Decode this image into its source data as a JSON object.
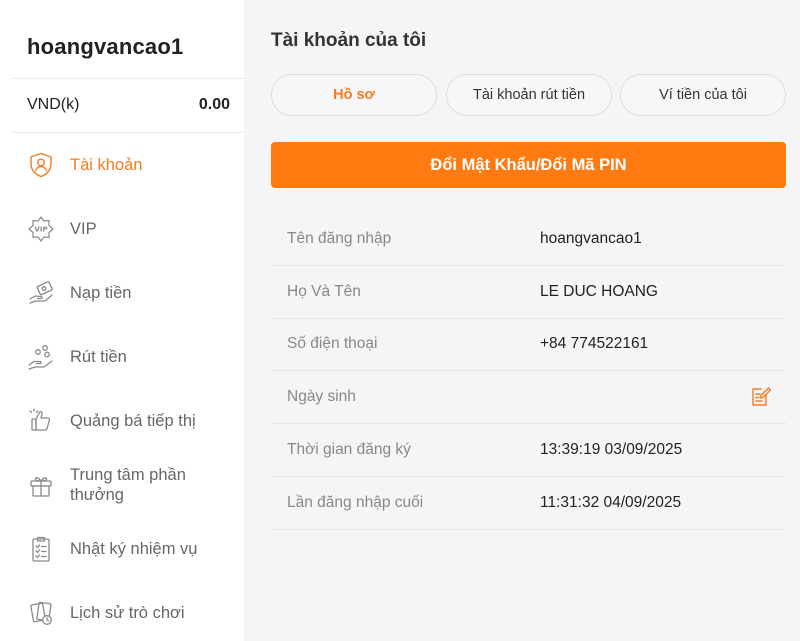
{
  "user": {
    "username": "hoangvancao1"
  },
  "balance": {
    "currency": "VND(k)",
    "amount": "0.00"
  },
  "sidebar": {
    "items": [
      {
        "label": "Tài khoản",
        "icon": "shield-user-icon",
        "active": true
      },
      {
        "label": "VIP",
        "icon": "vip-badge-icon"
      },
      {
        "label": "Nạp tiền",
        "icon": "deposit-icon"
      },
      {
        "label": "Rút tiền",
        "icon": "withdraw-icon"
      },
      {
        "label": "Quảng bá tiếp thị",
        "icon": "thumbs-up-icon"
      },
      {
        "label": "Trung tâm phần thưởng",
        "icon": "gift-icon"
      },
      {
        "label": "Nhật ký nhiệm vụ",
        "icon": "clipboard-icon"
      },
      {
        "label": "Lịch sử trò chơi",
        "icon": "game-history-icon"
      }
    ]
  },
  "main": {
    "title": "Tài khoản của tôi",
    "tabs": [
      {
        "label": "Hồ sơ",
        "active": true
      },
      {
        "label": "Tài khoản rút tiền"
      },
      {
        "label": "Ví tiền của tôi"
      }
    ],
    "change_password_label": "Đổi Mật Khẩu/Đổi Mã PIN",
    "profile": [
      {
        "label": "Tên đăng nhập",
        "value": "hoangvancao1"
      },
      {
        "label": "Họ Và Tên",
        "value": "LE DUC HOANG"
      },
      {
        "label": "Số điện thoại",
        "value": "+84 774522161"
      },
      {
        "label": "Ngày sinh",
        "value": "",
        "editable": true
      },
      {
        "label": "Thời gian đăng ký",
        "value": "13:39:19 03/09/2025"
      },
      {
        "label": "Lần đăng nhập cuối",
        "value": "11:31:32 04/09/2025"
      }
    ]
  },
  "colors": {
    "accent": "#ff7a10",
    "accent_text": "#f47b20",
    "muted": "#888888"
  }
}
